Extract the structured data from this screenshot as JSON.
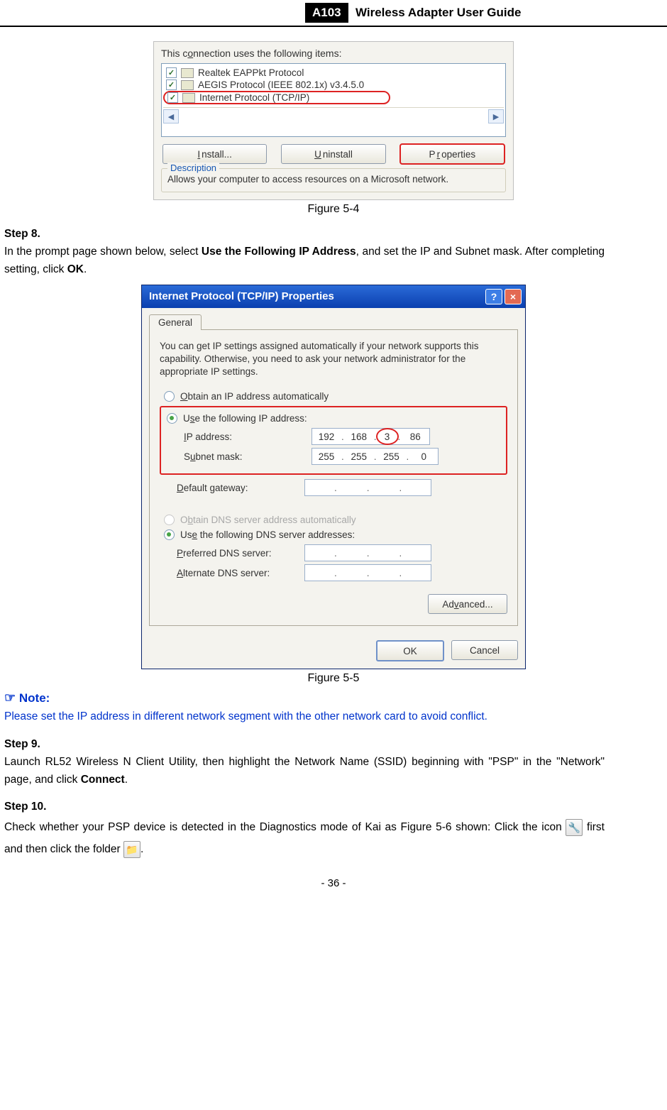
{
  "header": {
    "code": "A103",
    "title": "Wireless Adapter User Guide"
  },
  "fig54": {
    "title": "This connection uses the following items:",
    "items": [
      {
        "checked": true,
        "label": "Realtek EAPPkt Protocol"
      },
      {
        "checked": true,
        "label": "AEGIS Protocol (IEEE 802.1x) v3.4.5.0"
      },
      {
        "checked": true,
        "label": "Internet Protocol (TCP/IP)"
      }
    ],
    "buttons": {
      "install": "Install...",
      "uninstall": "Uninstall",
      "properties": "Properties"
    },
    "desc_legend": "Description",
    "desc_text": "Allows your computer to access resources on a Microsoft network.",
    "caption": "Figure 5-4"
  },
  "step8": {
    "label": "Step 8.",
    "t1": "In the prompt page shown below, select ",
    "bold1": "Use the Following IP Address",
    "t2": ", and set the IP and Subnet mask. After completing setting, click ",
    "bold2": "OK",
    "t3": "."
  },
  "fig55": {
    "win_title": "Internet Protocol (TCP/IP) Properties",
    "tab": "General",
    "intro": "You can get IP settings assigned automatically if your network supports this capability. Otherwise, you need to ask your network administrator for the appropriate IP settings.",
    "r_auto_ip": "Obtain an IP address automatically",
    "r_use_ip": "Use the following IP address:",
    "lbl_ip": "IP address:",
    "ip": [
      "192",
      "168",
      "3",
      "86"
    ],
    "lbl_subnet": "Subnet mask:",
    "subnet": [
      "255",
      "255",
      "255",
      "0"
    ],
    "lbl_gateway": "Default gateway:",
    "r_auto_dns": "Obtain DNS server address automatically",
    "r_use_dns": "Use the following DNS server addresses:",
    "lbl_pref": "Preferred DNS server:",
    "lbl_alt": "Alternate DNS server:",
    "advanced": "Advanced...",
    "ok": "OK",
    "cancel": "Cancel",
    "caption": "Figure 5-5"
  },
  "note": {
    "head": "Note:",
    "body": "Please set the IP address in different network segment with the other network card to avoid conflict."
  },
  "step9": {
    "label": "Step 9.",
    "t1": "Launch RL52 Wireless N Client Utility, then highlight the Network Name (SSID) beginning with \"PSP\" in the \"Network\" page, and click ",
    "bold1": "Connect",
    "t2": "."
  },
  "step10": {
    "label": "Step 10.",
    "t1": "Check whether your PSP device is detected in the Diagnostics mode of Kai as Figure 5-6 shown: Click the icon ",
    "t2": " first and then click the folder ",
    "t3": "."
  },
  "footer": "- 36 -"
}
